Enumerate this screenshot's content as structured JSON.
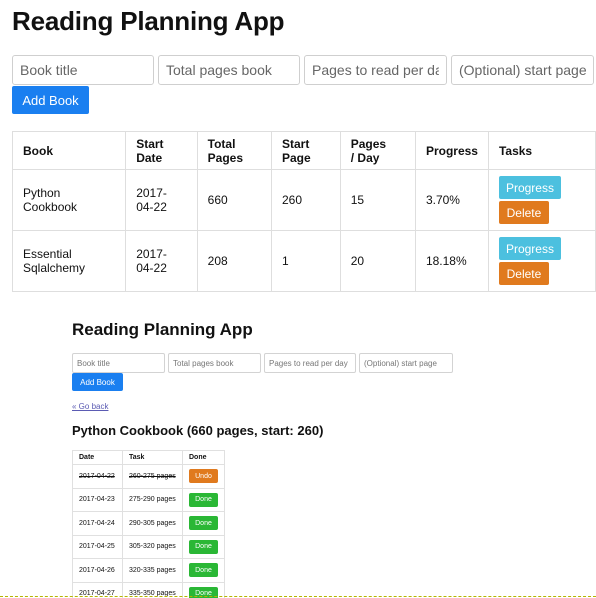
{
  "app": {
    "title": "Reading Planning App",
    "placeholders": {
      "title": "Book title",
      "total_pages": "Total pages book",
      "per_day": "Pages to read per day",
      "start_page": "(Optional) start page"
    },
    "add_button": "Add Book"
  },
  "table": {
    "headers": [
      "Book",
      "Start Date",
      "Total Pages",
      "Start Page",
      "Pages / Day",
      "Progress",
      "Tasks"
    ],
    "progress_label": "Progress",
    "delete_label": "Delete",
    "rows": [
      {
        "book": "Python Cookbook",
        "start_date": "2017-04-22",
        "total": "660",
        "start_page": "260",
        "per_day": "15",
        "progress": "3.70%"
      },
      {
        "book": "Essential Sqlalchemy",
        "start_date": "2017-04-22",
        "total": "208",
        "start_page": "1",
        "per_day": "20",
        "progress": "18.18%"
      }
    ]
  },
  "detail": {
    "title": "Reading Planning App",
    "placeholders": {
      "title": "Book title",
      "total_pages": "Total pages book",
      "per_day": "Pages to read per day",
      "start_page": "(Optional) start page"
    },
    "add_button": "Add Book",
    "back_link": "« Go back",
    "book_heading": "Python Cookbook (660 pages, start: 260)",
    "headers": [
      "Date",
      "Task",
      "Done"
    ],
    "tasks": [
      {
        "date": "2017-04-22",
        "task": "260-275 pages",
        "action": "Undo",
        "done": true
      },
      {
        "date": "2017-04-23",
        "task": "275-290 pages",
        "action": "Done",
        "done": false
      },
      {
        "date": "2017-04-24",
        "task": "290-305 pages",
        "action": "Done",
        "done": false
      },
      {
        "date": "2017-04-25",
        "task": "305-320 pages",
        "action": "Done",
        "done": false
      },
      {
        "date": "2017-04-26",
        "task": "320-335 pages",
        "action": "Done",
        "done": false
      },
      {
        "date": "2017-04-27",
        "task": "335-350 pages",
        "action": "Done",
        "done": false
      }
    ]
  },
  "colors": {
    "primary": "#1a7ff0",
    "progress": "#4cc0df",
    "delete": "#e07a1e",
    "done": "#2ab735"
  }
}
